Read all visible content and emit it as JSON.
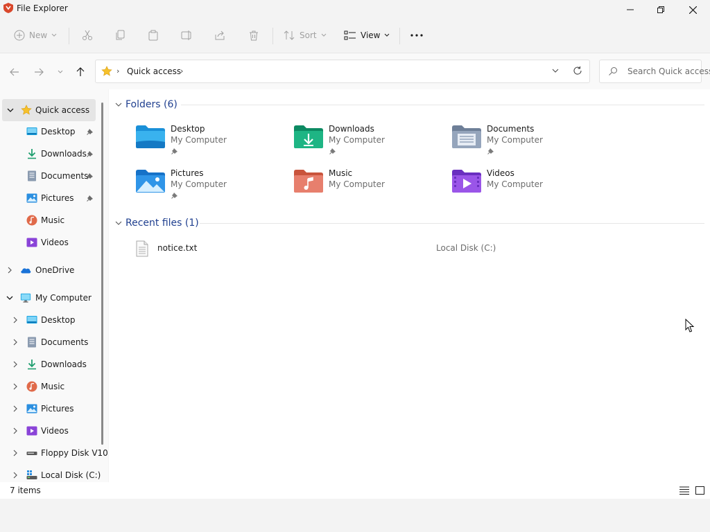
{
  "window": {
    "title": "File Explorer"
  },
  "toolbar": {
    "new_label": "New",
    "sort_label": "Sort",
    "view_label": "View"
  },
  "address": {
    "location": "Quick access"
  },
  "search": {
    "placeholder": "Search Quick access"
  },
  "sidebar": {
    "quick_access": "Quick access",
    "quick_items": [
      "Desktop",
      "Downloads",
      "Documents",
      "Pictures",
      "Music",
      "Videos"
    ],
    "onedrive": "OneDrive",
    "my_computer": "My Computer",
    "computer_items": [
      "Desktop",
      "Documents",
      "Downloads",
      "Music",
      "Pictures",
      "Videos",
      "Floppy Disk V10",
      "Local Disk (C:)"
    ]
  },
  "content": {
    "folders_header": "Folders (6)",
    "folders": [
      {
        "name": "Desktop",
        "location": "My Computer",
        "pinned": true,
        "icon": "desktop-folder-icon"
      },
      {
        "name": "Downloads",
        "location": "My Computer",
        "pinned": true,
        "icon": "downloads-folder-icon"
      },
      {
        "name": "Documents",
        "location": "My Computer",
        "pinned": true,
        "icon": "documents-folder-icon"
      },
      {
        "name": "Pictures",
        "location": "My Computer",
        "pinned": true,
        "icon": "pictures-folder-icon"
      },
      {
        "name": "Music",
        "location": "My Computer",
        "pinned": false,
        "icon": "music-folder-icon"
      },
      {
        "name": "Videos",
        "location": "My Computer",
        "pinned": false,
        "icon": "videos-folder-icon"
      }
    ],
    "recent_header": "Recent files (1)",
    "recent_files": [
      {
        "name": "notice.txt",
        "location": "Local Disk (C:)"
      }
    ]
  },
  "status": {
    "items": "7 items"
  },
  "colors": {
    "accent": "#1f3f8f",
    "window_bg": "#f3f3f3",
    "content_bg": "#ffffff"
  }
}
